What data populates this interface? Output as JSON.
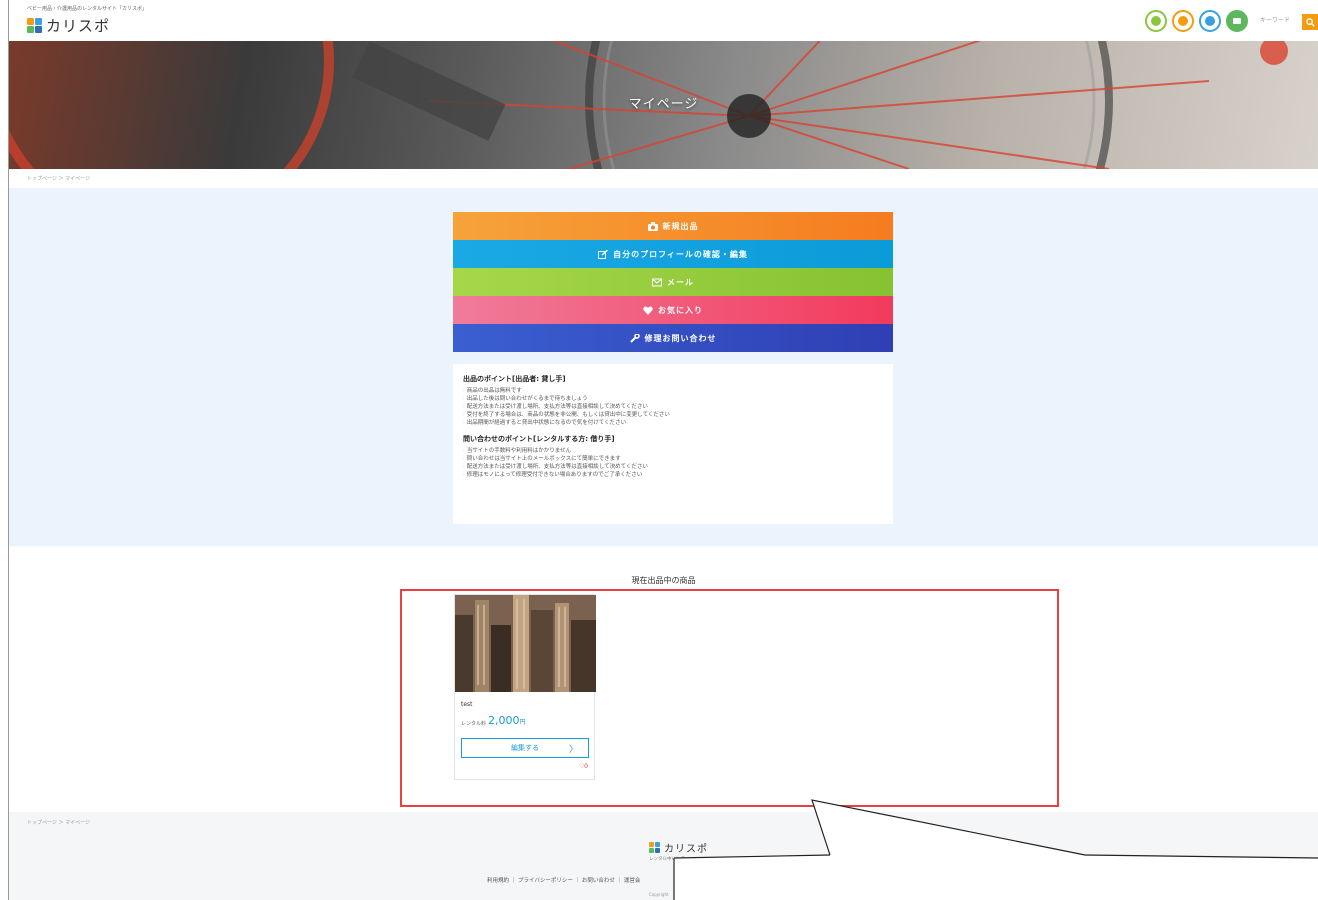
{
  "header": {
    "tagline": "ベビー用品・介護用品のレンタルサイト「カリスポ」",
    "logo_text": "カリスポ",
    "search_placeholder": "キーワード",
    "icons": [
      "profile-icon",
      "user-icon",
      "mail-icon",
      "chat-icon"
    ],
    "search_button_icon": "search-icon"
  },
  "hero": {
    "title": "マイページ"
  },
  "breadcrumb": "トップページ ＞ マイページ",
  "menu": {
    "items": [
      {
        "label": "新規出品",
        "icon": "camera-icon",
        "color": "#f57c1f"
      },
      {
        "label": "自分のプロフィールの確認・編集",
        "icon": "edit-icon",
        "color": "#0b9bd8"
      },
      {
        "label": "メール",
        "icon": "mail-icon",
        "color": "#86c232"
      },
      {
        "label": "お気に入り",
        "icon": "heart-icon",
        "color": "#f23a5c"
      },
      {
        "label": "修理お問い合わせ",
        "icon": "wrench-icon",
        "color": "#2f3fb4"
      }
    ]
  },
  "points": {
    "lender_title": "出品のポイント[出品者: 貸し手]",
    "lender_items": [
      "商品の出品は無料です",
      "出品した後は問い合わせがくるまで待ちましょう",
      "配送方法または受け渡し場所、支払方法等は直接相談して決めてください",
      "受付を終了する場合は、商品の状態を非公開、もしくは貸出中に変更してください",
      "出品期間が経過すると貸出中状態になるので気を付けてください"
    ],
    "borrower_title": "問い合わせのポイント[レンタルする方: 借り手]",
    "borrower_items": [
      "当サイトの手数料や利用料はかかりません",
      "問い合わせは当サイト上のメールボックスにて簡単にできます",
      "配送方法または受け渡し場所、支払方法等は直接相談して決めてください",
      "修理はモノによって修理受付できない場合ありますのでご了承ください"
    ]
  },
  "products": {
    "section_title": "現在出品中の商品",
    "items": [
      {
        "name": "test",
        "price_label": "レンタル料",
        "price": "2,000",
        "price_unit": "円",
        "edit_label": "編集する",
        "edit_chevron": "〉",
        "fav_count": "♡0"
      }
    ]
  },
  "footer": {
    "breadcrumb": "トップページ ＞ マイページ",
    "logo_text": "カリスポ",
    "tagline": "レンタル中レンタ",
    "links": "利用規約 ｜ プライバシーポリシー ｜ お問い合わせ ｜ 運営会",
    "copyright": "Copyright"
  }
}
